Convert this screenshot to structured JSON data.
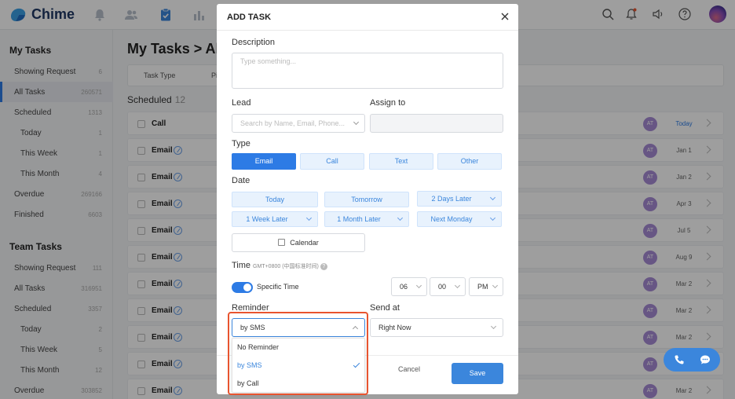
{
  "app": {
    "name": "Chime"
  },
  "sidebar": {
    "my_tasks_header": "My Tasks",
    "my_tasks": [
      {
        "label": "Showing Request",
        "count": "6"
      },
      {
        "label": "All Tasks",
        "count": "260571"
      },
      {
        "label": "Scheduled",
        "count": "1313"
      },
      {
        "label": "Today",
        "count": "1"
      },
      {
        "label": "This Week",
        "count": "1"
      },
      {
        "label": "This Month",
        "count": "4"
      },
      {
        "label": "Overdue",
        "count": "269166"
      },
      {
        "label": "Finished",
        "count": "6603"
      }
    ],
    "team_tasks_header": "Team Tasks",
    "team_tasks": [
      {
        "label": "Showing Request",
        "count": "111"
      },
      {
        "label": "All Tasks",
        "count": "316951"
      },
      {
        "label": "Scheduled",
        "count": "3357"
      },
      {
        "label": "Today",
        "count": "2"
      },
      {
        "label": "This Week",
        "count": "5"
      },
      {
        "label": "This Month",
        "count": "12"
      },
      {
        "label": "Overdue",
        "count": "303852"
      }
    ]
  },
  "main": {
    "title": "My Tasks > All",
    "filter_task_type": "Task Type",
    "filter_second": "Pi",
    "section_label": "Scheduled",
    "section_count": "12",
    "rows": [
      {
        "name": "Call",
        "avatar": "AT",
        "date": "Today"
      },
      {
        "name": "Email",
        "avatar": "AT",
        "date": "Jan 1"
      },
      {
        "name": "Email",
        "avatar": "AT",
        "date": "Jan 2"
      },
      {
        "name": "Email",
        "avatar": "AT",
        "date": "Apr 3"
      },
      {
        "name": "Email",
        "avatar": "AT",
        "date": "Jul 5"
      },
      {
        "name": "Email",
        "avatar": "AT",
        "date": "Aug 9"
      },
      {
        "name": "Email",
        "avatar": "AT",
        "date": "Mar 2"
      },
      {
        "name": "Email",
        "avatar": "AT",
        "date": "Mar 2"
      },
      {
        "name": "Email",
        "avatar": "AT",
        "date": "Mar 2"
      },
      {
        "name": "Email",
        "avatar": "AT",
        "date": ""
      },
      {
        "name": "Email",
        "avatar": "AT",
        "date": "Mar 2"
      }
    ]
  },
  "modal": {
    "title": "ADD TASK",
    "description_label": "Description",
    "description_placeholder": "Type something...",
    "lead_label": "Lead",
    "lead_placeholder": "Search by Name, Email, Phone...",
    "assign_label": "Assign to",
    "type_label": "Type",
    "types": [
      "Email",
      "Call",
      "Text",
      "Other"
    ],
    "active_type": "Email",
    "date_label": "Date",
    "date_row1": [
      "Today",
      "Tomorrow",
      "2 Days Later"
    ],
    "date_row2": [
      "1 Week Later",
      "1 Month Later",
      "Next Monday"
    ],
    "calendar_label": "Calendar",
    "time_label": "Time",
    "timezone": "GMT+0800 (中国标准时间)",
    "specific_time_label": "Specific Time",
    "specific_time_on": true,
    "hour": "06",
    "minute": "00",
    "ampm": "PM",
    "reminder_label": "Reminder",
    "reminder_value": "by SMS",
    "reminder_options": [
      "No Reminder",
      "by SMS",
      "by Call"
    ],
    "reminder_selected": "by SMS",
    "send_at_label": "Send at",
    "send_at_value": "Right Now",
    "cancel_label": "Cancel",
    "save_label": "Save"
  },
  "colors": {
    "accent": "#2d7be5",
    "highlight": "#e8542f",
    "avatar": "#a78bd6"
  }
}
